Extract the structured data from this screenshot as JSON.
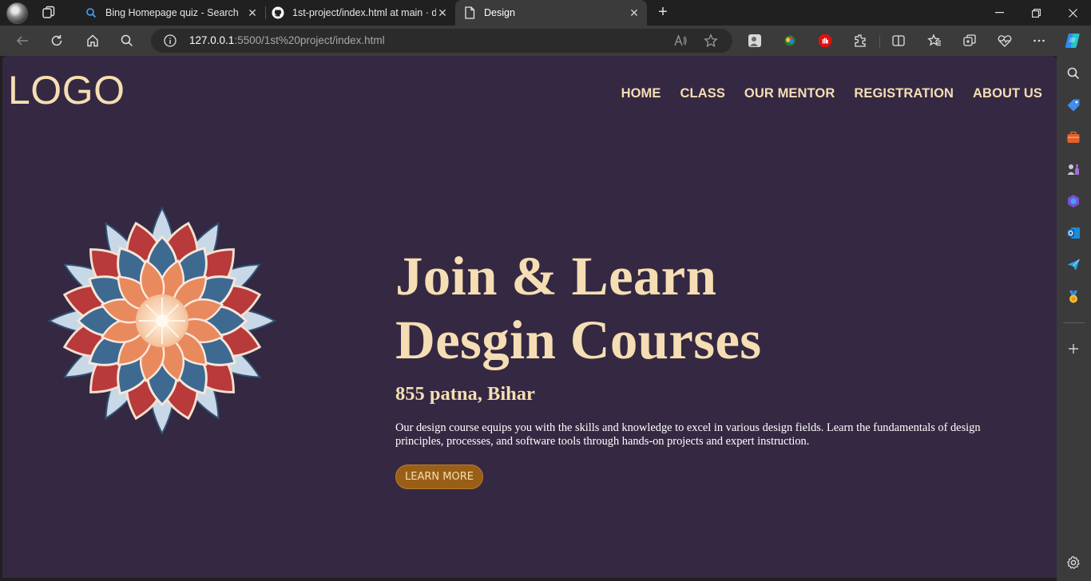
{
  "browser": {
    "tabs": [
      {
        "title": "Bing Homepage quiz - Search",
        "icon": "search-icon"
      },
      {
        "title": "1st-project/index.html at main · d",
        "icon": "github-icon"
      },
      {
        "title": "Design",
        "icon": "page-icon",
        "active": true
      }
    ],
    "address": {
      "host": "127.0.0.1",
      "rest": ":5500/1st%20project/index.html"
    }
  },
  "page": {
    "logo": "LOGO",
    "nav": [
      "HOME",
      "CLASS",
      "OUR MENTOR",
      "REGISTRATION",
      "ABOUT US"
    ],
    "hero": {
      "title_line1": "Join & Learn",
      "title_line2": "Desgin Courses",
      "subtitle": "855 patna, Bihar",
      "description": "Our design course equips you with the skills and knowledge to excel in various design fields. Learn the fundamentals of design principles, processes, and software tools through hands-on projects and expert instruction.",
      "button": "LEARN MORE"
    }
  },
  "colors": {
    "page_bg": "#352842",
    "accent_text": "#f5deb3",
    "button_bg": "#9a5f17",
    "browser_chrome": "#3b3b3b"
  }
}
